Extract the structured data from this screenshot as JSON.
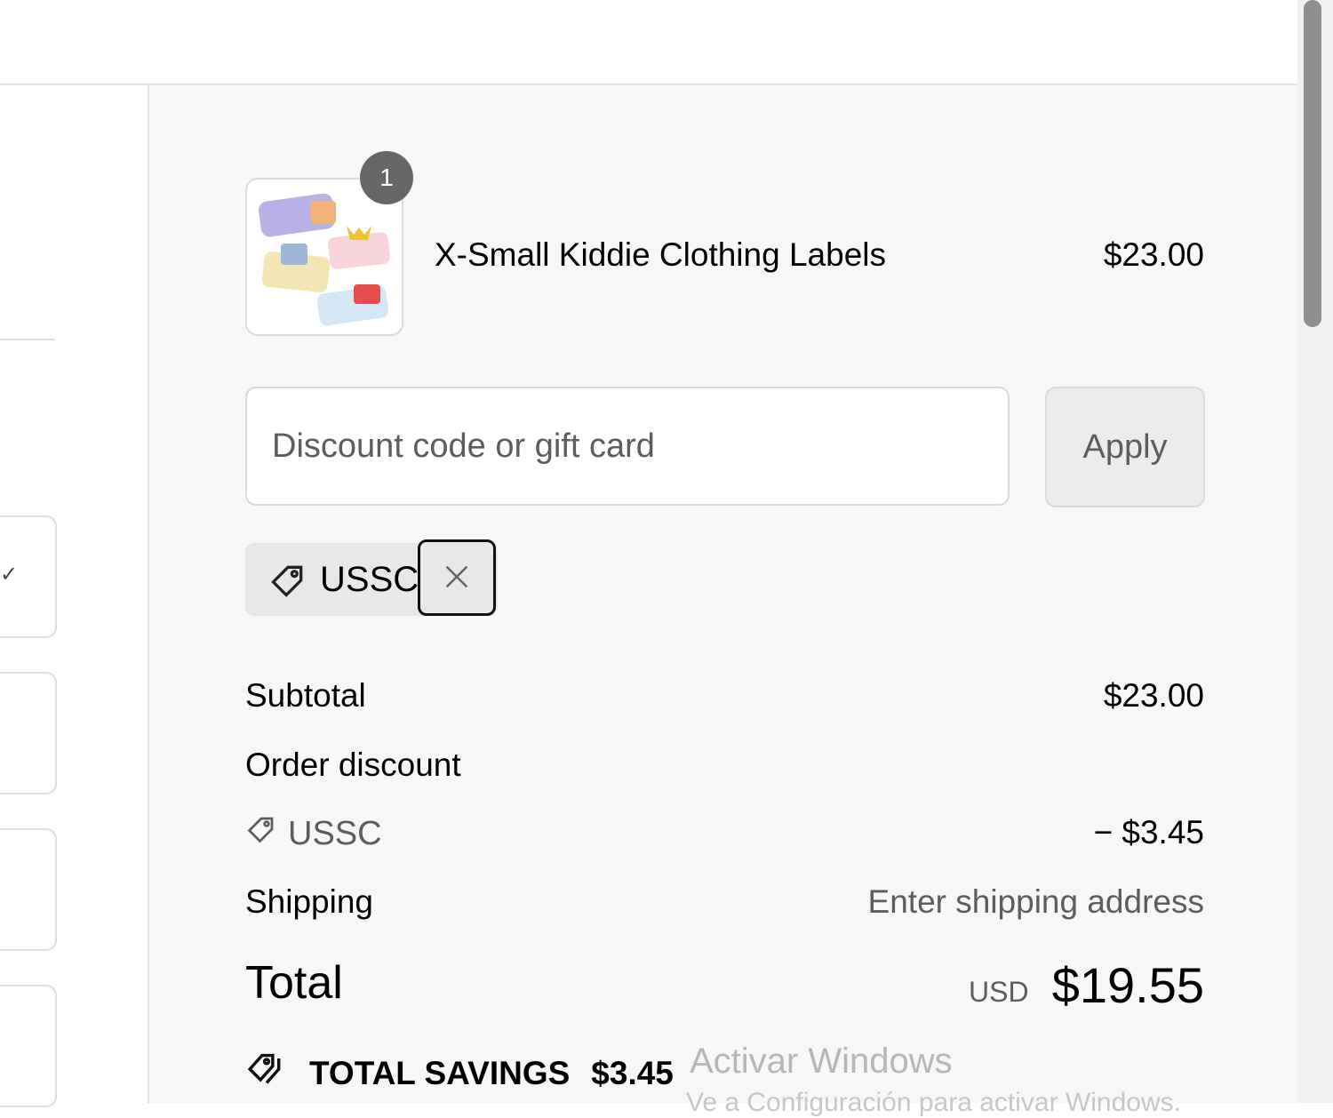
{
  "cart": {
    "item": {
      "quantity": "1",
      "name": "X-Small Kiddie Clothing Labels",
      "price": "$23.00"
    }
  },
  "discount": {
    "placeholder": "Discount code or gift card",
    "apply_label": "Apply",
    "applied_code": "USSC",
    "remove_icon": "close-icon"
  },
  "summary": {
    "subtotal_label": "Subtotal",
    "subtotal_value": "$23.00",
    "order_discount_label": "Order discount",
    "discount_code": "USSC",
    "discount_value": "− $3.45",
    "shipping_label": "Shipping",
    "shipping_value": "Enter shipping address",
    "total_label": "Total",
    "currency": "USD",
    "total_value": "$19.55",
    "savings_label": "TOTAL SAVINGS",
    "savings_value": "$3.45"
  },
  "os_overlay": {
    "activate_title": "Activar Windows",
    "activate_subtitle": "Ve a Configuración para activar Windows."
  },
  "colors": {
    "panel_background": "#f7f7f7",
    "badge": "#666666",
    "muted_text": "#5d5d5d"
  }
}
